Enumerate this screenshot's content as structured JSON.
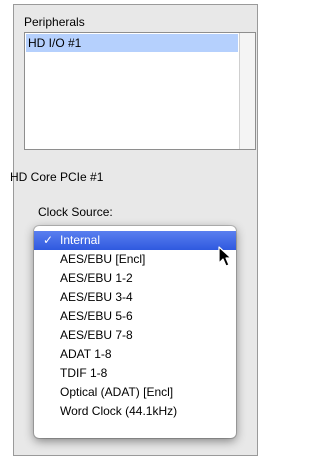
{
  "peripherals": {
    "label": "Peripherals",
    "items": [
      "HD I/O #1"
    ]
  },
  "device": {
    "name": "HD Core PCIe #1"
  },
  "clock_source": {
    "label": "Clock Source:",
    "check_mark": "✓",
    "selected_index": 0,
    "options": [
      "Internal",
      "AES/EBU [Encl]",
      "AES/EBU 1-2",
      "AES/EBU 3-4",
      "AES/EBU 5-6",
      "AES/EBU 7-8",
      "ADAT 1-8",
      "TDIF 1-8",
      "Optical (ADAT) [Encl]",
      "Word Clock (44.1kHz)"
    ]
  },
  "colors": {
    "selection_highlight": "#2f59df",
    "list_selection": "#b5d0fd"
  }
}
